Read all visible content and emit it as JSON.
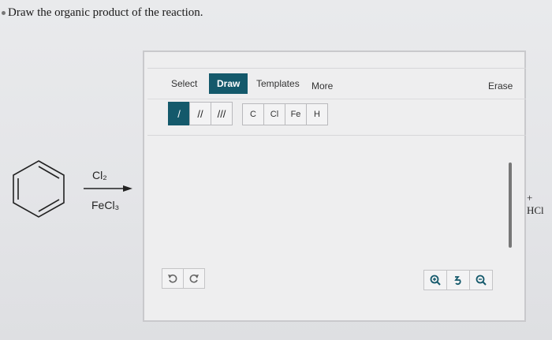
{
  "question": {
    "text": "Draw the organic product of the reaction."
  },
  "reaction": {
    "reagent_top": "Cl₂",
    "reagent_bottom": "FeCl₃",
    "byproduct": "+ HCl"
  },
  "toolbar": {
    "tabs": [
      {
        "label": "Select",
        "active": false
      },
      {
        "label": "Draw",
        "active": true
      },
      {
        "label": "Templates",
        "active": false
      },
      {
        "label": "More",
        "active": false
      }
    ],
    "erase_label": "Erase",
    "bonds": [
      "/",
      "//",
      "///"
    ],
    "atoms": [
      "C",
      "Cl",
      "Fe",
      "H"
    ]
  },
  "colors": {
    "accent": "#14596b"
  }
}
